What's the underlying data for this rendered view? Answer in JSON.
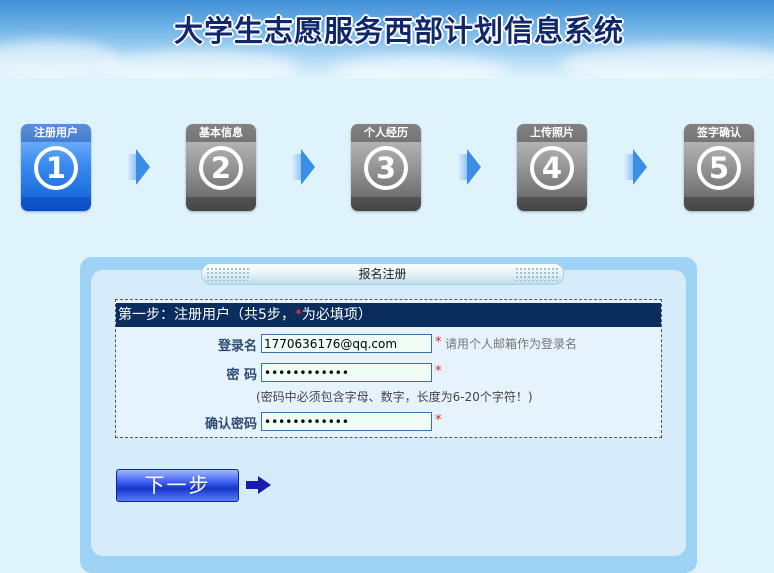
{
  "header": {
    "title": "大学生志愿服务西部计划信息系统"
  },
  "steps": [
    {
      "label": "注册用户",
      "number": "1",
      "active": true
    },
    {
      "label": "基本信息",
      "number": "2",
      "active": false
    },
    {
      "label": "个人经历",
      "number": "3",
      "active": false
    },
    {
      "label": "上传照片",
      "number": "4",
      "active": false
    },
    {
      "label": "签字确认",
      "number": "5",
      "active": false
    }
  ],
  "panel": {
    "title": "报名注册",
    "section_title_a": "第一步：注册用户（共5步，",
    "section_title_req": "*",
    "section_title_b": "为必填项）"
  },
  "form": {
    "login_label": "登录名",
    "login_value": "1770636176@qq.com",
    "login_hint": "请用个人邮箱作为登录名",
    "password_label": "密 码",
    "password_value": "••••••••••••",
    "password_rule": "(密码中必须包含字母、数字，长度为6-20个字符！)",
    "confirm_label": "确认密码",
    "confirm_value": "••••••••••••",
    "required_mark": "*"
  },
  "actions": {
    "next_label": "下一步"
  },
  "colors": {
    "accent": "#0b2d5e",
    "required": "#e02020",
    "active_step": "#3c8cf0"
  }
}
